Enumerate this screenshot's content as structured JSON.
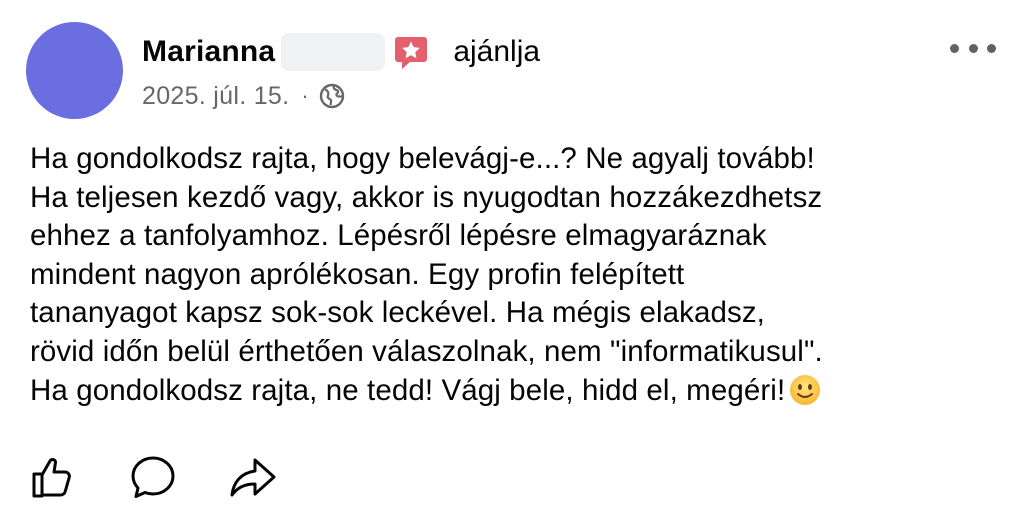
{
  "post": {
    "author": "Marianna",
    "recommend_icon": "recommendation-star-icon",
    "action_text": "ajánlja",
    "date": "2025. júl. 15.",
    "separator": "·",
    "privacy_icon": "globe-icon",
    "more_icon": "more-options-icon",
    "body": "Ha gondolkodsz rajta, hogy belevágj-e...? Ne agyalj tovább!\nHa teljesen kezdő vagy, akkor is nyugodtan hozzákezdhetsz\nehhez a tanfolyamhoz. Lépésről lépésre elmagyaráznak\nmindent nagyon aprólékosan. Egy profin felépített\ntananyagot kapsz sok-sok leckével. Ha mégis elakadsz,\nrövid időn belül érthetően válaszolnak, nem \"informatikusul\".\nHa gondolkodsz rajta, ne tedd! Vágj bele, hidd el, megéri!",
    "emoji": "slightly-smiling-face-emoji"
  },
  "actions": [
    {
      "name": "like",
      "icon": "thumbs-up-icon"
    },
    {
      "name": "comment",
      "icon": "comment-bubble-icon"
    },
    {
      "name": "share",
      "icon": "share-arrow-icon"
    }
  ],
  "colors": {
    "avatar": "#6a6ee0",
    "recommend_badge": "#e4606d",
    "secondary_text": "#65676b"
  }
}
